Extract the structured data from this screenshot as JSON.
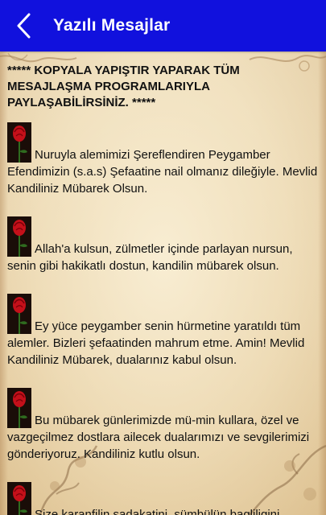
{
  "appbar": {
    "title": "Yazılı Mesajlar",
    "back_icon": "chevron-left-icon"
  },
  "colors": {
    "appbar": "#1111dd",
    "paper": "#efe0c3",
    "text": "#111111"
  },
  "intro": "***** KOPYALA YAPIŞTIR YAPARAK TÜM MESAJLAŞMA PROGRAMLARIYLA PAYLAŞABİLİRSİNİZ. *****",
  "messages": [
    {
      "icon": "rose-icon",
      "first": "Nuruyla alemimizi Şereflendiren Peygamber",
      "rest": "Efendimizin (s.a.s) Şefaatine nail olmanız dileğiyle. Mevlid Kandiliniz Mübarek Olsun."
    },
    {
      "icon": "rose-icon",
      "first": "Allah'a kulsun, zülmetler içinde parlayan nursun,",
      "rest": "senin gibi hakikatlı dostun, kandilin mübarek olsun."
    },
    {
      "icon": "rose-icon",
      "first": "Ey yüce peygamber senin hürmetine yaratıldı tüm",
      "rest": "alemler. Bizleri şefaatinden mahrum etme. Amin! Mevlid Kandiliniz Mübarek, dualarınız kabul olsun."
    },
    {
      "icon": "rose-icon",
      "first": "Bu mübarek günlerimizde mü-min kullara, özel ve",
      "rest": "vazgeçilmez dostlara ailecek dualarımızı ve sevgilerimizi gönderiyoruz. Kandiliniz kutlu olsun."
    },
    {
      "icon": "rose-icon",
      "first": "Size karanfilin sadakatini, sümbülün bagliligini,",
      "rest": ""
    }
  ]
}
